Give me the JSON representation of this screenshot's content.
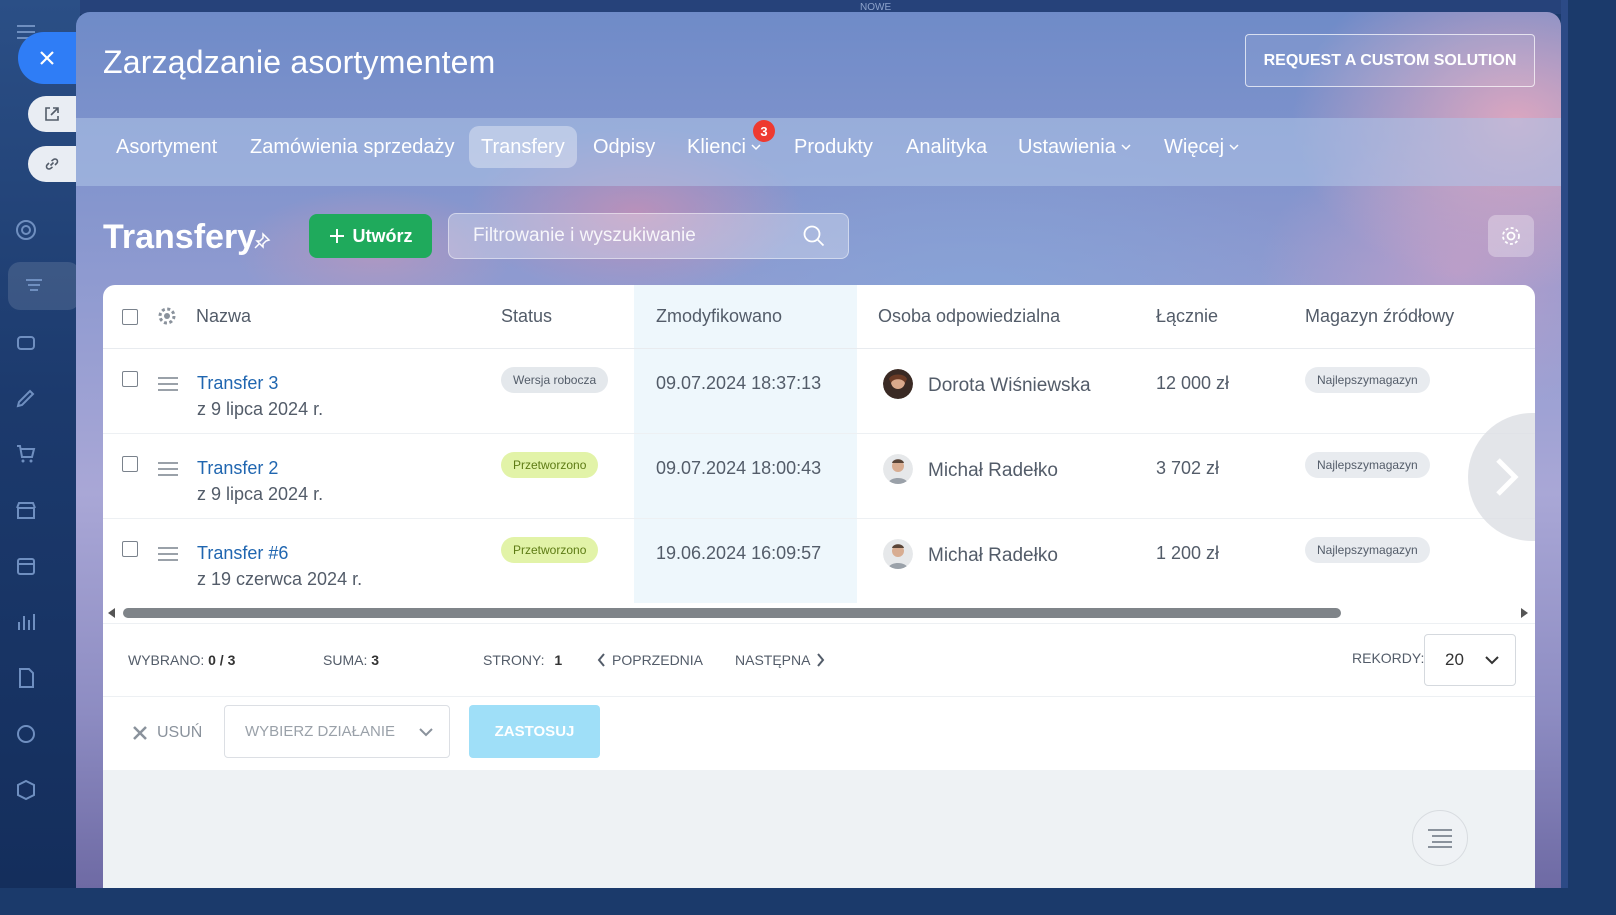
{
  "background_top_label": "NOWE",
  "panel": {
    "title": "Zarządzanie asortymentem",
    "custom_button": "REQUEST A CUSTOM SOLUTION"
  },
  "tabs": [
    {
      "label": "Asortyment"
    },
    {
      "label": "Zamówienia sprzedaży"
    },
    {
      "label": "Transfery",
      "active": true
    },
    {
      "label": "Odpisy"
    },
    {
      "label": "Klienci",
      "badge": "3"
    },
    {
      "label": "Produkty"
    },
    {
      "label": "Analityka"
    },
    {
      "label": "Ustawienia"
    },
    {
      "label": "Więcej"
    }
  ],
  "toolbar": {
    "page_title": "Transfery",
    "create_label": "Utwórz",
    "search_placeholder": "Filtrowanie i wyszukiwanie"
  },
  "grid": {
    "columns": [
      "Nazwa",
      "Status",
      "Zmodyfikowano",
      "Osoba odpowiedzialna",
      "Łącznie",
      "Magazyn źródłowy"
    ],
    "rows": [
      {
        "name": "Transfer 3",
        "date_line": "z 9 lipca 2024 r.",
        "status": "Wersja robocza",
        "status_type": "draft",
        "modified": "09.07.2024 18:37:13",
        "person": "Dorota Wiśniewska",
        "total": "12 000 zł",
        "warehouse": "Najlepszymagazyn"
      },
      {
        "name": "Transfer 2",
        "date_line": "z 9 lipca 2024 r.",
        "status": "Przetworzono",
        "status_type": "done",
        "modified": "09.07.2024 18:00:43",
        "person": "Michał Radełko",
        "total": "3 702 zł",
        "warehouse": "Najlepszymagazyn"
      },
      {
        "name": "Transfer #6",
        "date_line": "z 19 czerwca 2024 r.",
        "status": "Przetworzono",
        "status_type": "done",
        "modified": "19.06.2024 16:09:57",
        "person": "Michał Radełko",
        "total": "1 200 zł",
        "warehouse": "Najlepszymagazyn"
      }
    ]
  },
  "footer": {
    "selected_label": "WYBRANO:",
    "selected_value": "0 / 3",
    "sum_label": "SUMA:",
    "sum_value": "3",
    "pages_label": "STRONY:",
    "pages_value": "1",
    "prev_label": "POPRZEDNIA",
    "next_label": "NASTĘPNA",
    "records_label": "REKORDY:",
    "records_value": "20"
  },
  "actions": {
    "delete_label": "USUŃ",
    "select_placeholder": "WYBIERZ DZIAŁANIE",
    "apply_label": "ZASTOSUJ"
  },
  "colors": {
    "accent_blue": "#2f7df6",
    "create_green": "#1faa5c",
    "badge_red": "#ee3a30",
    "link": "#2066b0",
    "apply_disabled": "#9fdff8"
  }
}
